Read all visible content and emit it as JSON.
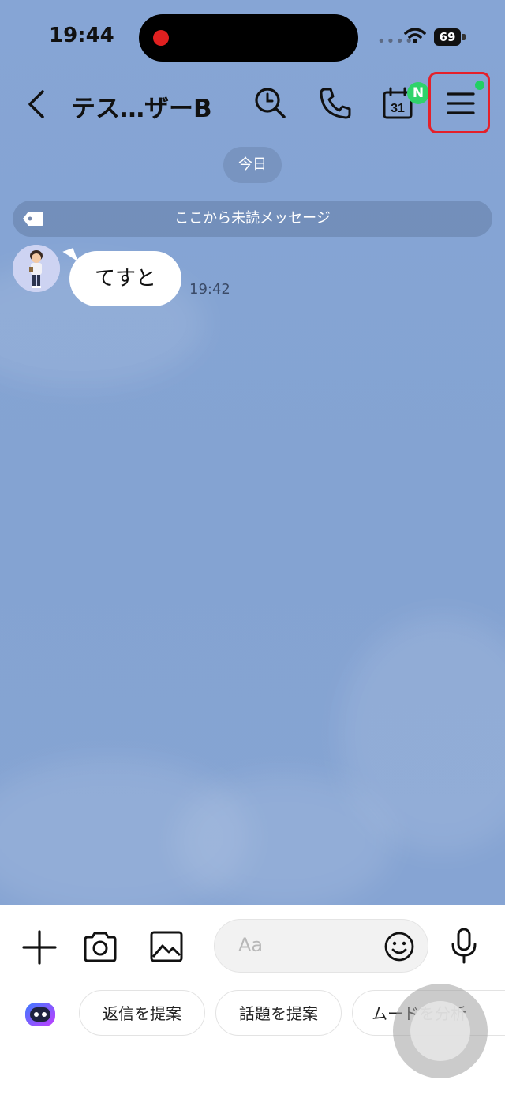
{
  "status_bar": {
    "time": "19:44",
    "battery": "69",
    "signal": "••••"
  },
  "header": {
    "title": "テス…ザーB",
    "calendar_day": "31",
    "calendar_badge": "N"
  },
  "chat": {
    "date_chip": "今日",
    "unread_divider": "ここから未読メッセージ",
    "messages": [
      {
        "text": "てすと",
        "time": "19:42"
      }
    ]
  },
  "composer": {
    "placeholder": "Aa"
  },
  "suggestions": {
    "items": [
      "返信を提案",
      "話題を提案",
      "ムードを分析"
    ]
  },
  "colors": {
    "accent_green": "#22d063",
    "highlight_red": "#e4202a"
  }
}
